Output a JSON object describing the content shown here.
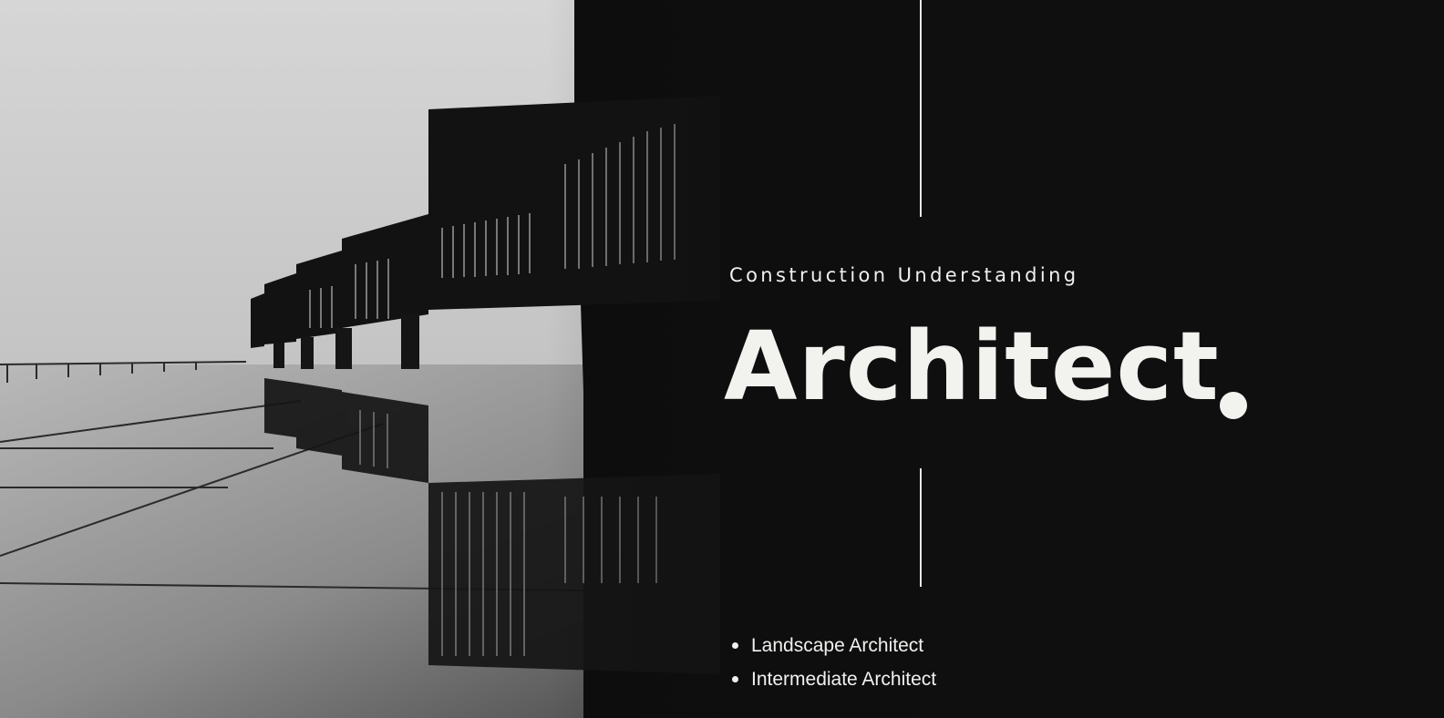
{
  "banner": {
    "subtitle": "Construction Understanding",
    "title": "Architect",
    "bullets": [
      "Landscape Architect",
      "Intermediate Architect"
    ]
  },
  "photo": {
    "subject": "building-facade-reflection-icon",
    "style": "monochrome"
  },
  "colors": {
    "background": "#0f0f0f",
    "text": "#f2f2ef",
    "sky": "#cfcfcf",
    "divider": "#e8e8e8"
  }
}
